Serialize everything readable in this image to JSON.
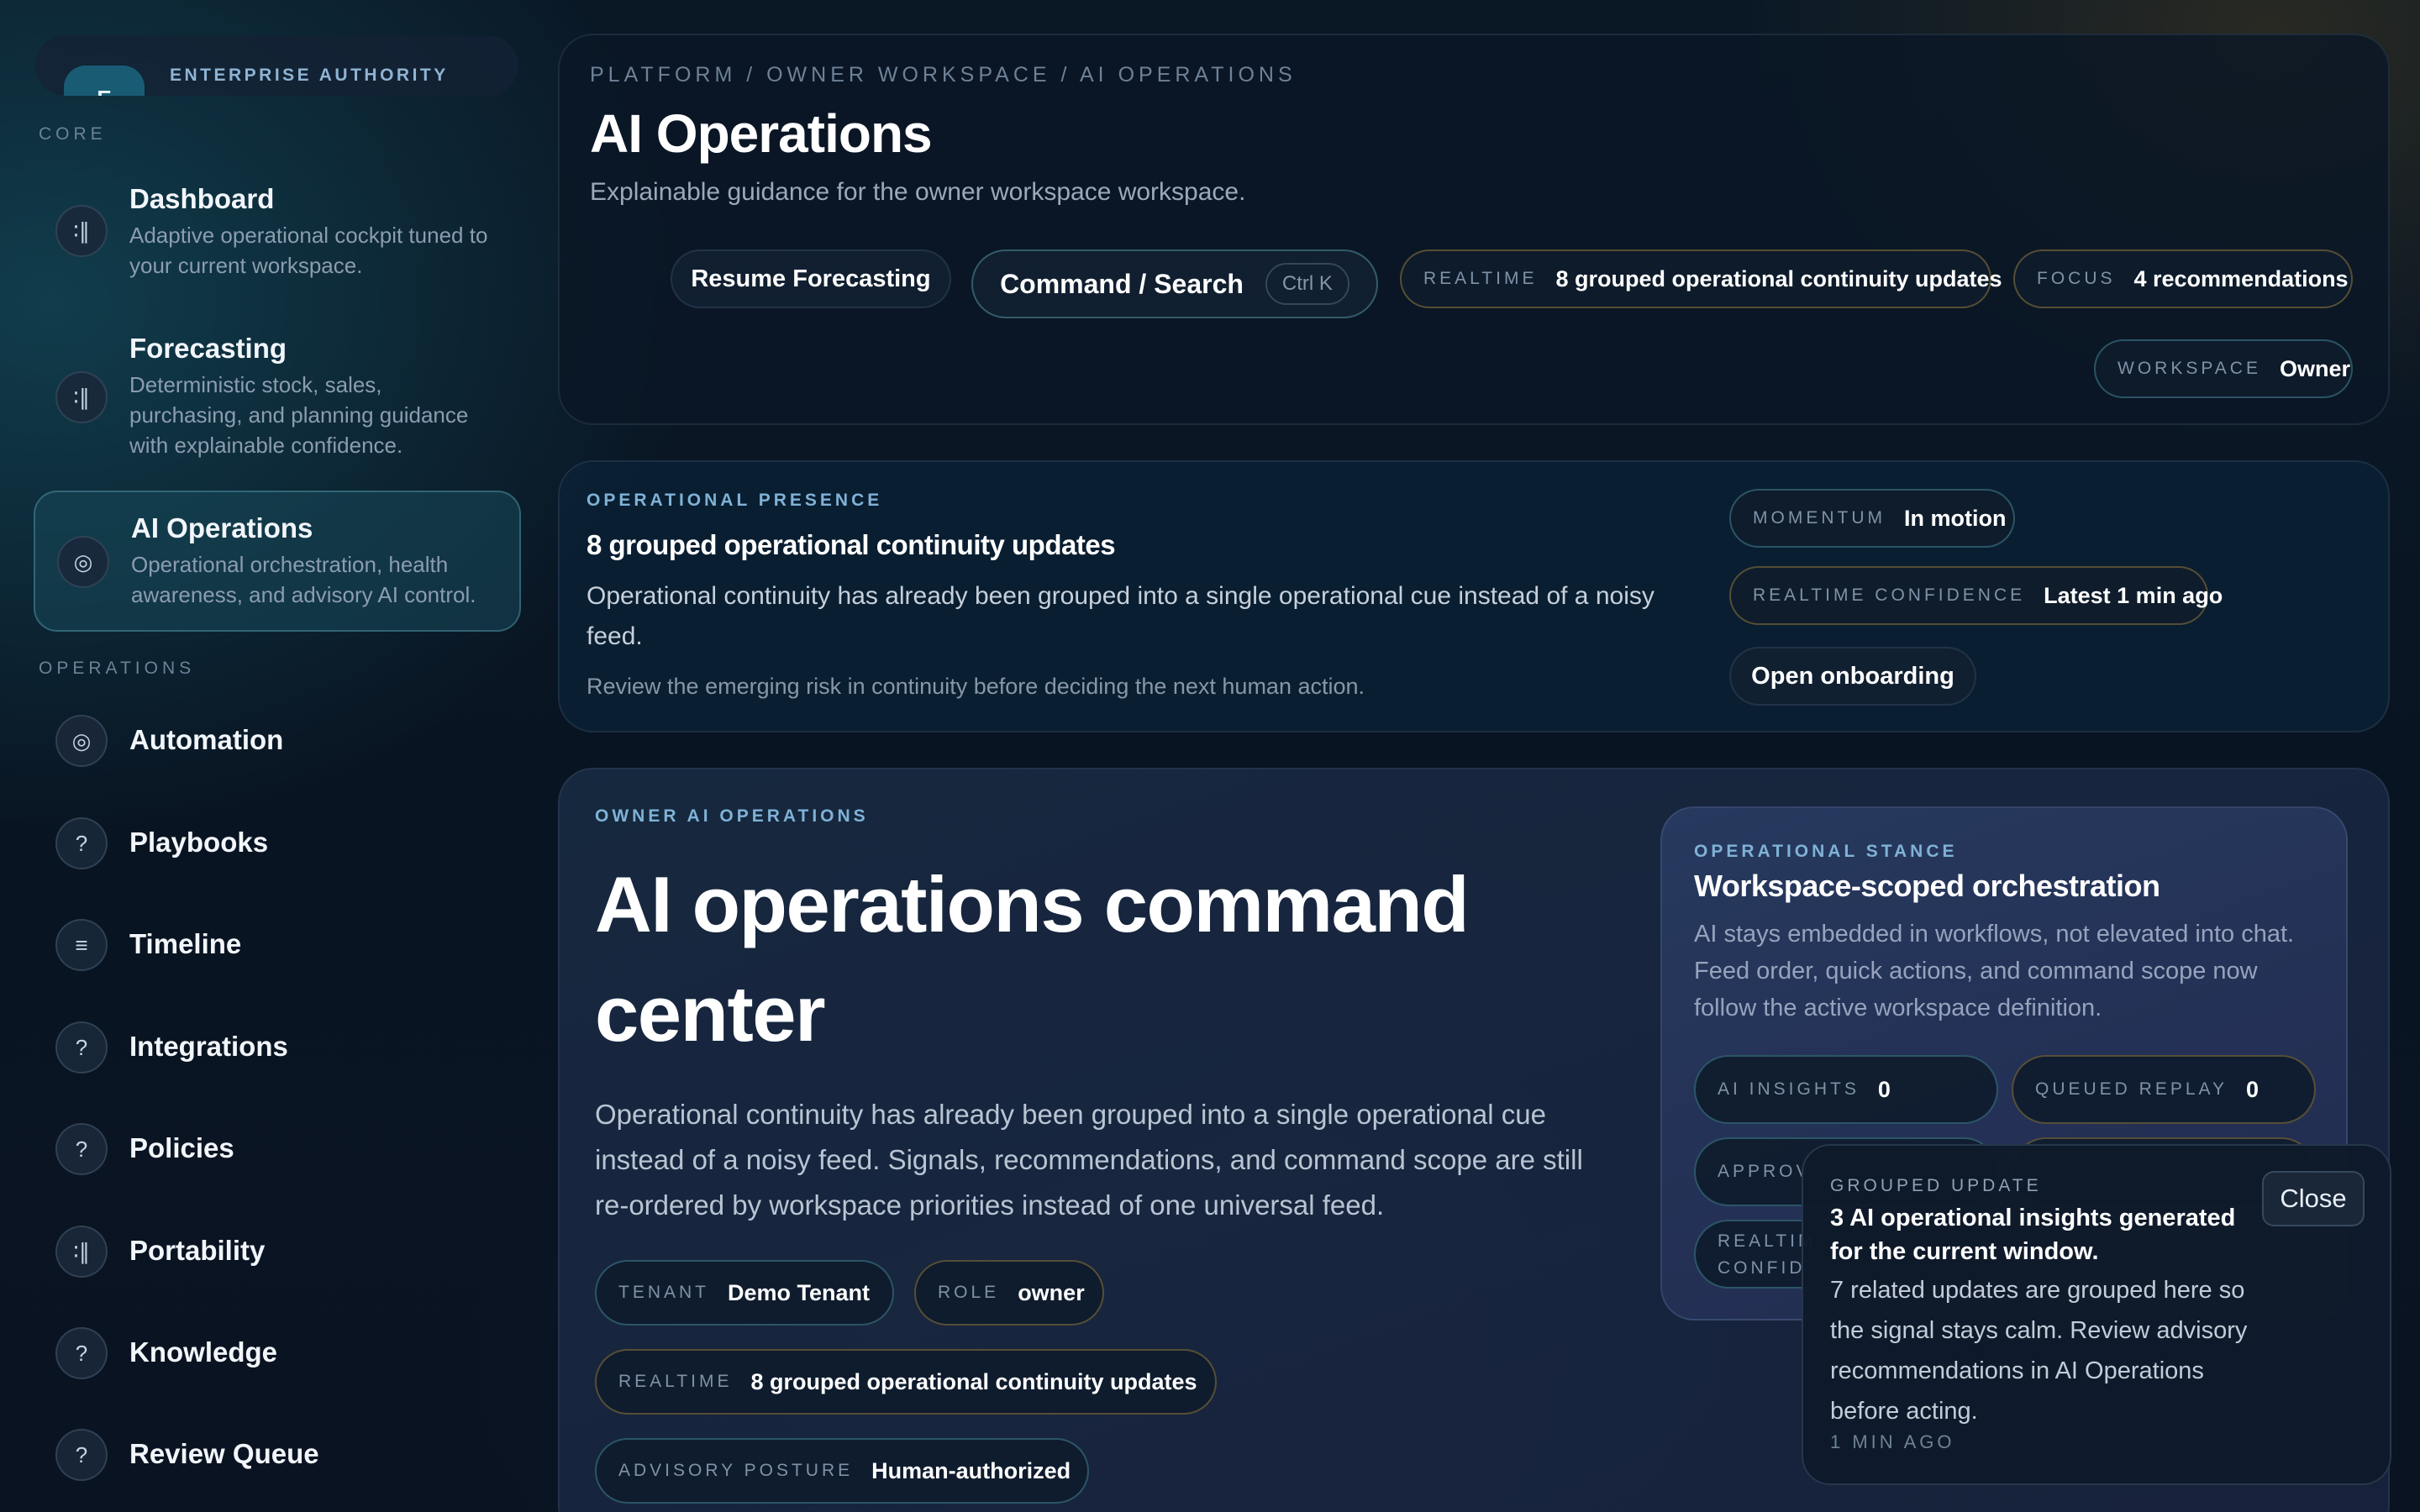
{
  "brand": {
    "mark": "E",
    "label": "ENTERPRISE AUTHORITY"
  },
  "sidebar": {
    "core_label": "CORE",
    "operations_label": "OPERATIONS",
    "core_items": [
      {
        "title": "Dashboard",
        "desc": "Adaptive operational cockpit tuned to your current workspace.",
        "icon": "bar-chart-icon",
        "glyph": "∶∥"
      },
      {
        "title": "Forecasting",
        "desc": "Deterministic stock, sales, purchasing, and planning guidance with explainable confidence.",
        "icon": "bar-chart-icon",
        "glyph": "∶∥"
      },
      {
        "title": "AI Operations",
        "desc": "Operational orchestration, health awareness, and advisory AI control.",
        "icon": "orbit-icon",
        "glyph": "◎"
      }
    ],
    "ops_items": [
      {
        "title": "Automation",
        "icon": "orbit-icon",
        "glyph": "◎"
      },
      {
        "title": "Playbooks",
        "icon": "help-circle-icon",
        "glyph": "?"
      },
      {
        "title": "Timeline",
        "icon": "list-icon",
        "glyph": "≡"
      },
      {
        "title": "Integrations",
        "icon": "help-circle-icon",
        "glyph": "?"
      },
      {
        "title": "Policies",
        "icon": "help-circle-icon",
        "glyph": "?"
      },
      {
        "title": "Portability",
        "icon": "bar-chart-icon",
        "glyph": "∶∥"
      },
      {
        "title": "Knowledge",
        "icon": "help-circle-icon",
        "glyph": "?"
      },
      {
        "title": "Review Queue",
        "icon": "help-circle-icon",
        "glyph": "?"
      }
    ]
  },
  "header": {
    "breadcrumb": "PLATFORM / OWNER WORKSPACE / AI OPERATIONS",
    "title": "AI Operations",
    "subtitle": "Explainable guidance for the owner workspace workspace.",
    "resume_label": "Resume Forecasting",
    "command_label": "Command / Search",
    "command_shortcut": "Ctrl K",
    "realtime_key": "REALTIME",
    "realtime_value": "8 grouped operational continuity updates",
    "focus_key": "FOCUS",
    "focus_value": "4 recommendations",
    "workspace_key": "WORKSPACE",
    "workspace_value": "Owner"
  },
  "presence": {
    "eyebrow": "OPERATIONAL PRESENCE",
    "title": "8 grouped operational continuity updates",
    "body": "Operational continuity has already been grouped into a single operational cue instead of a noisy feed.",
    "note": "Review the emerging risk in continuity before deciding the next human action.",
    "momentum_key": "MOMENTUM",
    "momentum_value": "In motion",
    "confidence_key": "REALTIME CONFIDENCE",
    "confidence_value": "Latest 1 min ago",
    "onboarding_label": "Open onboarding"
  },
  "command_center": {
    "eyebrow": "OWNER AI OPERATIONS",
    "title": "AI operations command center",
    "body": "Operational continuity has already been grouped into a single operational cue instead of a noisy feed. Signals, recommendations, and command scope are still re-ordered by workspace priorities instead of one universal feed.",
    "tenant_key": "TENANT",
    "tenant_value": "Demo Tenant",
    "role_key": "ROLE",
    "role_value": "owner",
    "realtime_key": "REALTIME",
    "realtime_value": "8 grouped operational continuity updates",
    "advisory_key": "ADVISORY POSTURE",
    "advisory_value": "Human-authorized"
  },
  "stance": {
    "eyebrow": "OPERATIONAL STANCE",
    "title": "Workspace-scoped orchestration",
    "body": "AI stays embedded in workflows, not elevated into chat. Feed order, quick actions, and command scope now follow the active workspace definition.",
    "insights_key": "AI INSIGHTS",
    "insights_value": "0",
    "replay_key": "QUEUED REPLAY",
    "replay_value": "0",
    "approvals_key": "APPROV",
    "confidence_key_1": "REALTIM",
    "confidence_key_2": "CONFID"
  },
  "toast": {
    "eyebrow": "GROUPED UPDATE",
    "title": "3 AI operational insights generated for the current window.",
    "body": "7 related updates are grouped here so the signal stays calm. Review advisory recommendations in AI Operations before acting.",
    "time": "1 MIN AGO",
    "close_label": "Close"
  }
}
